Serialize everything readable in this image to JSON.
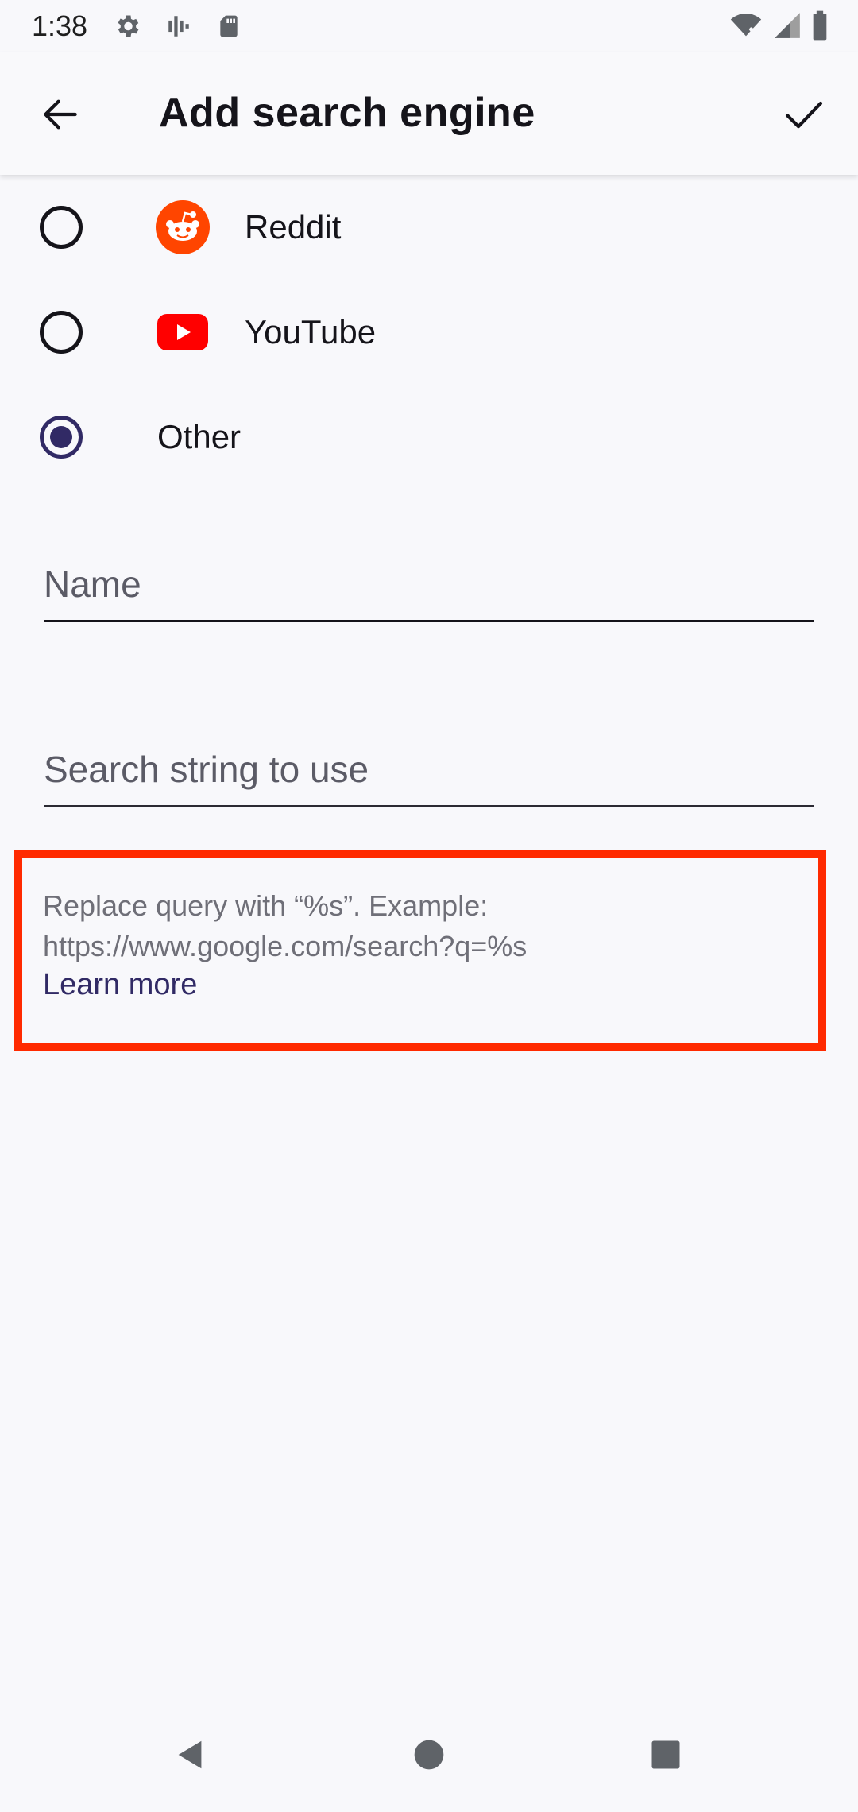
{
  "status_bar": {
    "time": "1:38",
    "left_icons": [
      "settings-gear-icon",
      "signal-bars-icon",
      "sd-card-icon"
    ],
    "right_icons": [
      "wifi-icon",
      "cell-signal-icon",
      "battery-icon"
    ]
  },
  "toolbar": {
    "title": "Add search engine",
    "back_icon": "arrow-left-icon",
    "confirm_icon": "check-icon"
  },
  "engines": [
    {
      "label": "Reddit",
      "icon": "reddit-icon",
      "selected": false
    },
    {
      "label": "YouTube",
      "icon": "youtube-icon",
      "selected": false
    },
    {
      "label": "Other",
      "icon": "",
      "selected": true
    }
  ],
  "form": {
    "name_placeholder": "Name",
    "search_string_placeholder": "Search string to use"
  },
  "helper": {
    "line1": "Replace query with “%s”. Example:",
    "line2": "https://www.google.com/search?q=%s",
    "learn_more": "Learn more"
  },
  "colors": {
    "background": "#f8f8fb",
    "accent": "#312a65",
    "highlight_border": "#ff2a00",
    "reddit": "#ff4500",
    "youtube": "#ff0000"
  },
  "nav_bar": {
    "icons": [
      "back-triangle-icon",
      "home-circle-icon",
      "recents-square-icon"
    ]
  }
}
